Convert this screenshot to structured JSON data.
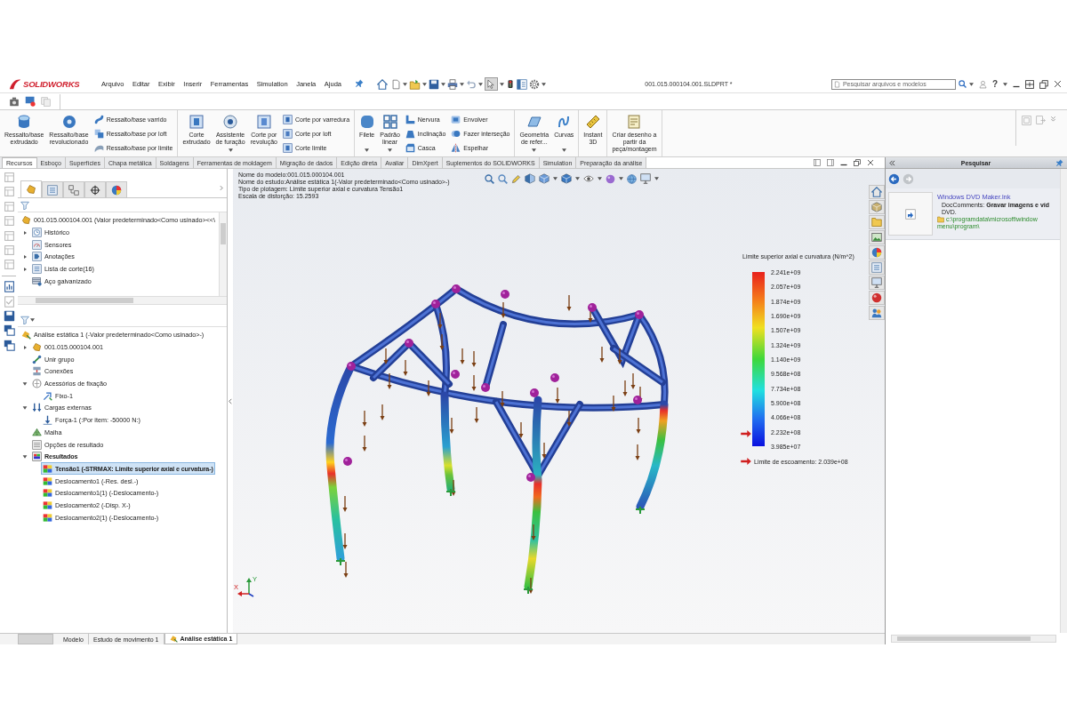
{
  "title_bar": {
    "logo": "SOLIDWORKS",
    "menu": [
      "Arquivo",
      "Editar",
      "Exibir",
      "Inserir",
      "Ferramentas",
      "Simulation",
      "Janela",
      "Ajuda"
    ],
    "select_tool": {
      "selected": true
    },
    "document_title": "001.015.000104.001.SLDPRT *",
    "search": {
      "placeholder": "Pesquisar arquivos e modelos"
    },
    "help": "?"
  },
  "ribbon": {
    "groups": [
      {
        "columns": [
          {
            "kind": "large",
            "buttons": [
              {
                "label": "Ressalto/base\nextrudado",
                "dropdown": false
              }
            ]
          },
          {
            "kind": "large",
            "buttons": [
              {
                "label": "Ressalto/base\nrevolucionado",
                "dropdown": false
              }
            ]
          },
          {
            "kind": "stack",
            "buttons": [
              {
                "label": "Ressalto/base varrido"
              },
              {
                "label": "Ressalto/base por loft"
              },
              {
                "label": "Ressalto/base por limite"
              }
            ]
          }
        ]
      },
      {
        "columns": [
          {
            "kind": "large",
            "buttons": [
              {
                "label": "Corte\nextrudado",
                "dropdown": false
              }
            ]
          },
          {
            "kind": "large",
            "buttons": [
              {
                "label": "Assistente\nde furação",
                "dropdown": true
              }
            ]
          },
          {
            "kind": "large",
            "buttons": [
              {
                "label": "Corte por\nrevolução",
                "dropdown": false
              }
            ]
          },
          {
            "kind": "stack",
            "buttons": [
              {
                "label": "Corte por varredura"
              },
              {
                "label": "Corte por loft"
              },
              {
                "label": "Corte limite"
              }
            ]
          }
        ]
      },
      {
        "columns": [
          {
            "kind": "large",
            "buttons": [
              {
                "label": "Filete",
                "dropdown": true
              }
            ]
          },
          {
            "kind": "large",
            "buttons": [
              {
                "label": "Padrão\nlinear",
                "dropdown": true
              }
            ]
          },
          {
            "kind": "stack",
            "buttons": [
              {
                "label": "Nervura"
              },
              {
                "label": "Inclinação"
              },
              {
                "label": "Casca"
              }
            ]
          },
          {
            "kind": "stack",
            "buttons": [
              {
                "label": "Envolver"
              },
              {
                "label": "Fazer interseção"
              },
              {
                "label": "Espelhar"
              }
            ]
          }
        ]
      },
      {
        "columns": [
          {
            "kind": "large",
            "buttons": [
              {
                "label": "Geometria\nde refer...",
                "dropdown": true
              }
            ]
          },
          {
            "kind": "large",
            "buttons": [
              {
                "label": "Curvas",
                "dropdown": true
              }
            ]
          }
        ]
      },
      {
        "columns": [
          {
            "kind": "large",
            "buttons": [
              {
                "label": "Instant\n3D",
                "dropdown": false
              }
            ]
          }
        ]
      },
      {
        "columns": [
          {
            "kind": "large",
            "buttons": [
              {
                "label": "Criar desenho a\npartir da\npeça/montagem",
                "dropdown": false
              }
            ]
          }
        ]
      }
    ]
  },
  "command_tabs": [
    {
      "label": "Recursos",
      "selected": true
    },
    {
      "label": "Esboço",
      "selected": false
    },
    {
      "label": "Superfícies",
      "selected": false
    },
    {
      "label": "Chapa metálica",
      "selected": false
    },
    {
      "label": "Soldagens",
      "selected": false
    },
    {
      "label": "Ferramentas de moldagem",
      "selected": false
    },
    {
      "label": "Migração de dados",
      "selected": false
    },
    {
      "label": "Edição direta",
      "selected": false
    },
    {
      "label": "Avaliar",
      "selected": false
    },
    {
      "label": "DimXpert",
      "selected": false
    },
    {
      "label": "Suplementos do SOLIDWORKS",
      "selected": false
    },
    {
      "label": "Simulation",
      "selected": false
    },
    {
      "label": "Preparação da análise",
      "selected": false
    }
  ],
  "left_toolbar": [
    {
      "disabled": true
    },
    {
      "disabled": true
    },
    {
      "disabled": true
    },
    {
      "disabled": true
    },
    {
      "disabled": true
    },
    {
      "disabled": true
    },
    {
      "disabled": true
    },
    {
      "disabled": false
    },
    {
      "disabled": true
    },
    {
      "disabled": false
    },
    {
      "disabled": false
    },
    {
      "disabled": false
    }
  ],
  "feature_manager": {
    "tabs": [
      {
        "selected": true
      },
      {
        "selected": false
      },
      {
        "selected": false
      },
      {
        "selected": false
      },
      {
        "selected": false
      }
    ],
    "tree": [
      {
        "label": "001.015.000104.001 (Valor predeterminado<Como usinado><<\\",
        "selected": false,
        "children": [
          {
            "label": "Histórico",
            "expanded": false,
            "selected": false
          },
          {
            "label": "Sensores",
            "selected": false
          },
          {
            "label": "Anotações",
            "expanded": false,
            "selected": false
          },
          {
            "label": "Lista de corte(16)",
            "expanded": false,
            "selected": false
          },
          {
            "label": "Aço galvanizado",
            "selected": false
          }
        ]
      }
    ]
  },
  "simulation_tree": [
    {
      "label": "Análise estática 1 (-Valor predeterminado<Como usinado>-)",
      "selected": false,
      "active": false,
      "children": [
        {
          "label": "001.015.000104.001",
          "expanded": false,
          "selected": false,
          "active": false
        },
        {
          "label": "Unir grupo",
          "selected": false,
          "active": false
        },
        {
          "label": "Conexões",
          "selected": false,
          "active": false
        },
        {
          "label": "Acessórios de fixação",
          "expanded": true,
          "selected": false,
          "active": false,
          "children": [
            {
              "label": "Fixo-1",
              "selected": false,
              "active": false
            }
          ]
        },
        {
          "label": "Cargas externas",
          "expanded": true,
          "selected": false,
          "active": false,
          "children": [
            {
              "label": "Força-1 (:Por item: -50000 N:)",
              "selected": false,
              "active": false
            }
          ]
        },
        {
          "label": "Malha",
          "selected": false,
          "active": false
        },
        {
          "label": "Opções de resultado",
          "selected": false,
          "active": false
        },
        {
          "label": "Resultados",
          "expanded": true,
          "selected": false,
          "active": true,
          "children": [
            {
              "label": "Tensão1 (-STRMAX: Limite superior axial e curvatura-)",
              "selected": true,
              "active": true
            },
            {
              "label": "Deslocamento1 (-Res. desl.-)",
              "selected": false,
              "active": false
            },
            {
              "label": "Deslocamento1(1) (-Deslocamento-)",
              "selected": false,
              "active": false
            },
            {
              "label": "Deslocamento2 (-Disp. X-)",
              "selected": false,
              "active": false
            },
            {
              "label": "Deslocamento2(1) (-Deslocamento-)",
              "selected": false,
              "active": false
            }
          ]
        }
      ]
    }
  ],
  "viewport": {
    "info_lines": [
      "Nome do modelo:001.015.000104.001",
      "Nome do estudo:Análise estática 1(-Valor predeterminado<Como usinado>-)",
      "Tipo de plotagem: Limite superior axial e curvatura Tensão1",
      "Escala de distorção: 15.2593"
    ],
    "legend": {
      "title": "Limite superior axial e curvatura (N/m^2)",
      "values": [
        "2.241e+09",
        "2.057e+09",
        "1.874e+09",
        "1.690e+09",
        "1.507e+09",
        "1.324e+09",
        "1.140e+09",
        "9.568e+08",
        "7.734e+08",
        "5.900e+08",
        "4.066e+08",
        "2.232e+08",
        "3.985e+07"
      ],
      "marker": {
        "level": 0.07
      },
      "yield_label": "Limite de escoamento: 2.039e+08"
    },
    "triad_labels": [
      "Y",
      "X"
    ]
  },
  "task_pane": {
    "title": "Pesquisar",
    "results": [
      {
        "title": "Windows DVD Maker.lnk",
        "lines": [
          "DocComments: **Gravar imagens e víd**",
          "DVD."
        ],
        "path_lines": [
          "c:\\programdata\\microsoft\\window",
          "menu\\program\\"
        ]
      }
    ]
  },
  "bottom_tabs": [
    {
      "label": "Modelo",
      "selected": false
    },
    {
      "label": "Estudo de movimento 1",
      "selected": false
    },
    {
      "label": "Análise estática 1",
      "selected": true
    }
  ]
}
